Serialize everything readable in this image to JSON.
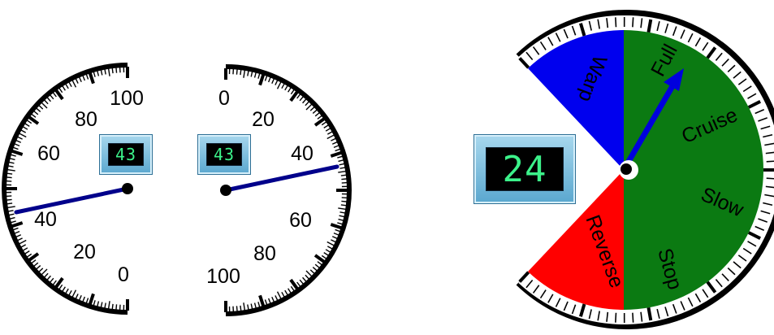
{
  "gauge_left": {
    "labels": [
      "100",
      "80",
      "60",
      "40",
      "20",
      "0"
    ],
    "value": 43,
    "display": "43"
  },
  "gauge_middle": {
    "labels": [
      "0",
      "20",
      "40",
      "60",
      "80",
      "100"
    ],
    "value": 43,
    "display": "43"
  },
  "telegraph": {
    "display": "24",
    "sectors": {
      "warp": {
        "label": "Warp",
        "color": "#0000ee"
      },
      "ahead": {
        "color": "#0b7a12"
      },
      "reverse": {
        "label": "Reverse",
        "color": "#ff0000"
      }
    },
    "ahead_labels": [
      "Full",
      "Cruise",
      "Slow",
      "Stop"
    ]
  },
  "colors": {
    "needle_gauge": "#00008b",
    "needle_telegraph": "#0000dd",
    "lcd_digits": "#3cf28a"
  }
}
